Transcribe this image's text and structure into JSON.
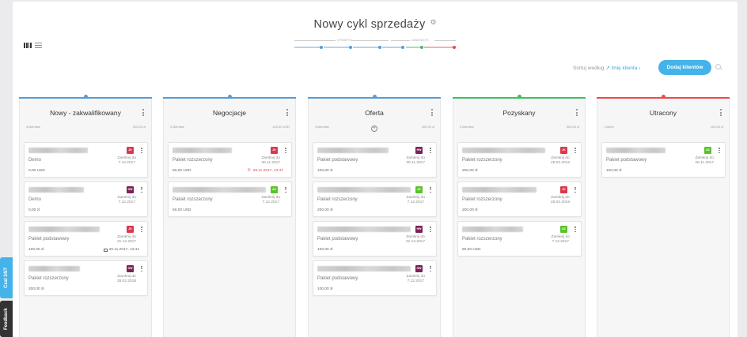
{
  "header": {
    "title": "Nowy cykl sprzedaży",
    "stage_labels": {
      "open": "OTWARTE",
      "closed": "ZAMKNIĘTE"
    }
  },
  "toolbar": {
    "sort_label": "Sortuj według",
    "sort_value": "Imię klienta",
    "add_button": "Dodaj klientów"
  },
  "colors": {
    "accent": "#44b3e9",
    "open_stage": "#5b9bd5",
    "won": "#3fbf5f",
    "lost": "#e84b4b",
    "badge_jk": "#d9394d",
    "badge_hw": "#7a2257",
    "badge_az": "#5cc22b"
  },
  "columns": [
    {
      "title": "Nowy - zakwalifikowany",
      "count": "4 klientów",
      "sum": "200,00 zł",
      "color": "#5b9bd5",
      "cards": [
        {
          "badge": "JK",
          "badge_color": "#d9394d",
          "product": "Demo",
          "close_label": "Zamknij do",
          "close_date": "7.12.2017",
          "value": "0,00 USD",
          "activity": ""
        },
        {
          "badge": "HW",
          "badge_color": "#7a2257",
          "product": "Demo",
          "close_label": "Zamknij do",
          "close_date": "7.12.2017",
          "value": "0,00 zł",
          "activity": ""
        },
        {
          "badge": "JK",
          "badge_color": "#d9394d",
          "product": "Pakiet podstawowy",
          "close_label": "Zamknij do",
          "close_date": "31.12.2017",
          "value": "100,00 zł",
          "activity": "30.11.2017, 13:41",
          "activity_icon": "mail-icon"
        },
        {
          "badge": "HW",
          "badge_color": "#7a2257",
          "product": "Pakiet rozszerzony",
          "close_label": "Zamknij do",
          "close_date": "28.02.2018",
          "value": "200,00 zł",
          "activity": ""
        }
      ]
    },
    {
      "title": "Negocjacje",
      "count": "2 klientów",
      "sum": "100,00 USD",
      "color": "#5b9bd5",
      "cards": [
        {
          "badge": "JK",
          "badge_color": "#d9394d",
          "product": "Pakiet rozszerzony",
          "close_label": "Zamknij do",
          "close_date": "30.11.2017",
          "value": "50,00 USD",
          "activity": "28.11.2017, 13:47",
          "activity_icon": "phone-icon"
        },
        {
          "badge": "AZ",
          "badge_color": "#5cc22b",
          "product": "Pakiet rozszerzony",
          "close_label": "Zamknij do",
          "close_date": "7.12.2017",
          "value": "50,00 USD",
          "activity": ""
        }
      ]
    },
    {
      "title": "Oferta",
      "count": "4 klientów",
      "sum": "400,00 zł",
      "color": "#5b9bd5",
      "cards": [
        {
          "badge": "HW",
          "badge_color": "#7a2257",
          "product": "Pakiet podstawowy",
          "close_label": "Zamknij do",
          "close_date": "30.11.2017",
          "value": "100,00 zł",
          "activity": ""
        },
        {
          "badge": "AZ",
          "badge_color": "#5cc22b",
          "product": "Pakiet rozszerzony",
          "close_label": "Zamknij do",
          "close_date": "7.12.2017",
          "value": "200,00 zł",
          "activity": ""
        },
        {
          "badge": "HW",
          "badge_color": "#7a2257",
          "product": "Pakiet podstawowy",
          "close_label": "Zamknij do",
          "close_date": "31.12.2017",
          "value": "100,00 zł",
          "activity": ""
        },
        {
          "badge": "HW",
          "badge_color": "#7a2257",
          "product": "Pakiet podstawowy",
          "close_label": "Zamknij do",
          "close_date": "7.12.2017",
          "value": "100,00 zł",
          "activity": ""
        }
      ]
    },
    {
      "title": "Pozyskany",
      "count": "3 klientów",
      "sum": "300,00 zł",
      "color": "#3fbf5f",
      "cards": [
        {
          "badge": "JK",
          "badge_color": "#d9394d",
          "product": "Pakiet rozszerzony",
          "close_label": "Zamknij do",
          "close_date": "28.02.2018",
          "value": "200,00 zł",
          "activity": ""
        },
        {
          "badge": "JK",
          "badge_color": "#d9394d",
          "product": "Pakiet rozszerzony",
          "close_label": "Zamknij do",
          "close_date": "28.02.2018",
          "value": "200,00 zł",
          "activity": ""
        },
        {
          "badge": "AZ",
          "badge_color": "#5cc22b",
          "product": "Pakiet rozszerzony",
          "close_label": "Zamknij do",
          "close_date": "7.12.2017",
          "value": "50,00 USD",
          "activity": ""
        }
      ]
    },
    {
      "title": "Utracony",
      "count": "1 klient",
      "sum": "100,00 zł",
      "color": "#e84b4b",
      "cards": [
        {
          "badge": "AZ",
          "badge_color": "#5cc22b",
          "product": "Pakiet podstawowy",
          "close_label": "Zamknij do",
          "close_date": "28.11.2017",
          "value": "100,00 zł",
          "activity": ""
        }
      ]
    }
  ],
  "side_tabs": {
    "chat": "Czat 24/7",
    "feedback": "Feedback"
  }
}
